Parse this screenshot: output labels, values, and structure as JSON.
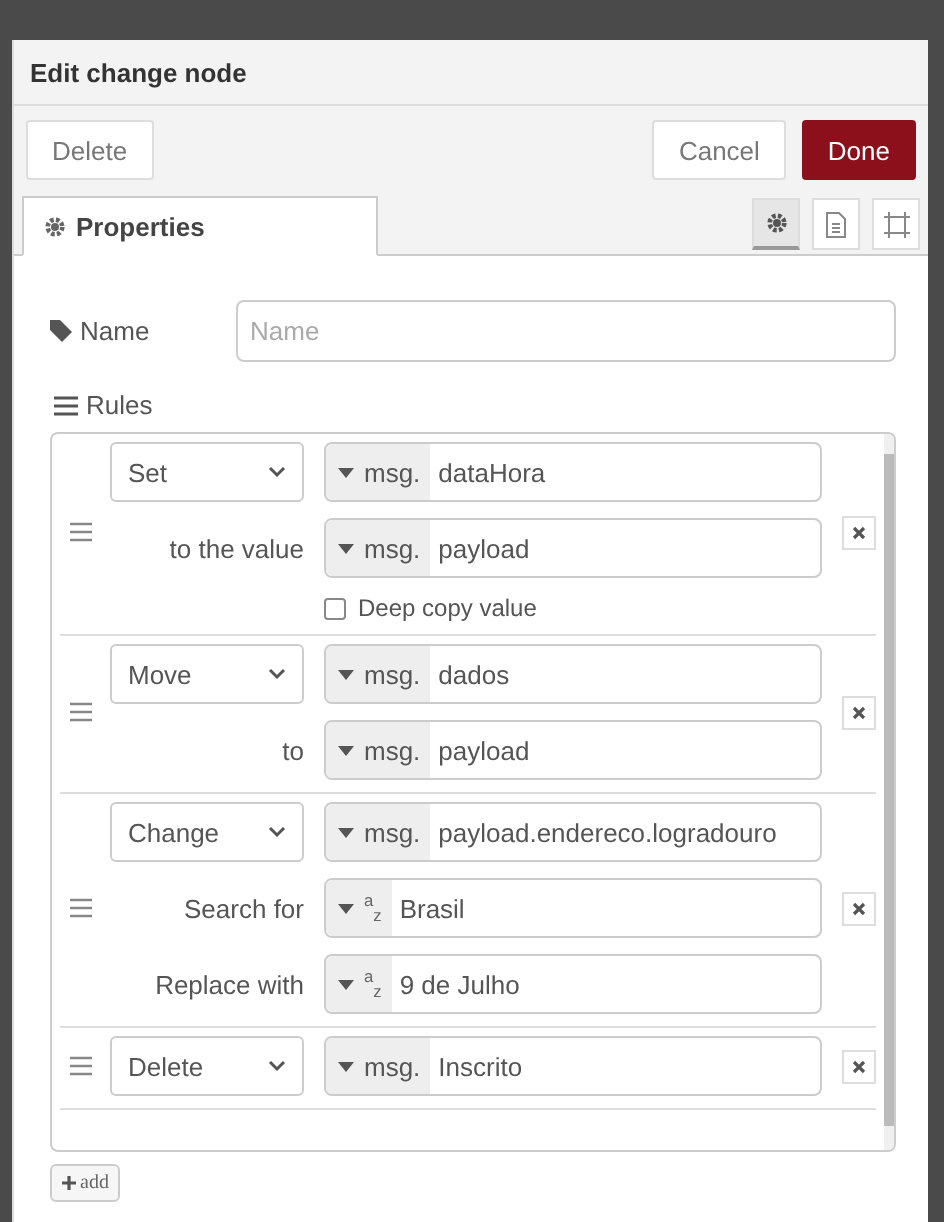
{
  "dialog": {
    "title": "Edit change node"
  },
  "buttons": [
    {
      "label": "Delete",
      "kind": "plain"
    },
    {
      "label": "Cancel",
      "kind": "plain"
    },
    {
      "label": "Done",
      "kind": "primary"
    }
  ],
  "tabs": [
    {
      "label": "Properties",
      "selected": true
    }
  ],
  "tab_icons": [
    {
      "kind": "settings",
      "selected": true
    },
    {
      "kind": "description",
      "selected": false
    },
    {
      "kind": "appearance",
      "selected": false
    }
  ],
  "name_field": {
    "label": "Name",
    "placeholder": "Name"
  },
  "rules_label": "Rules",
  "rules": [
    {
      "action": "Set",
      "lines": [
        {
          "kind": "msg",
          "prefix": "msg.",
          "value": "dataHora"
        },
        {
          "label": "to the value",
          "kind": "msg",
          "prefix": "msg.",
          "value": "payload"
        }
      ],
      "deep_copy": {
        "label": "Deep copy value",
        "checked": false
      }
    },
    {
      "action": "Move",
      "lines": [
        {
          "kind": "msg",
          "prefix": "msg.",
          "value": "dados"
        },
        {
          "label": "to",
          "kind": "msg",
          "prefix": "msg.",
          "value": "payload"
        }
      ]
    },
    {
      "action": "Change",
      "lines": [
        {
          "kind": "msg",
          "prefix": "msg.",
          "value": "payload.endereco.logradouro"
        },
        {
          "label": "Search for",
          "kind": "str",
          "prefix": "$^{a}$$_{z}$",
          "value": "Brasil"
        },
        {
          "label": "Replace with",
          "kind": "str",
          "prefix": "$^{a}$$_{z}$",
          "value": "9 de Julho"
        }
      ]
    },
    {
      "action": "Delete",
      "lines": [
        {
          "kind": "msg",
          "prefix": "msg.",
          "value": "Inscrito"
        }
      ]
    }
  ],
  "add_button": {
    "label": "add"
  }
}
